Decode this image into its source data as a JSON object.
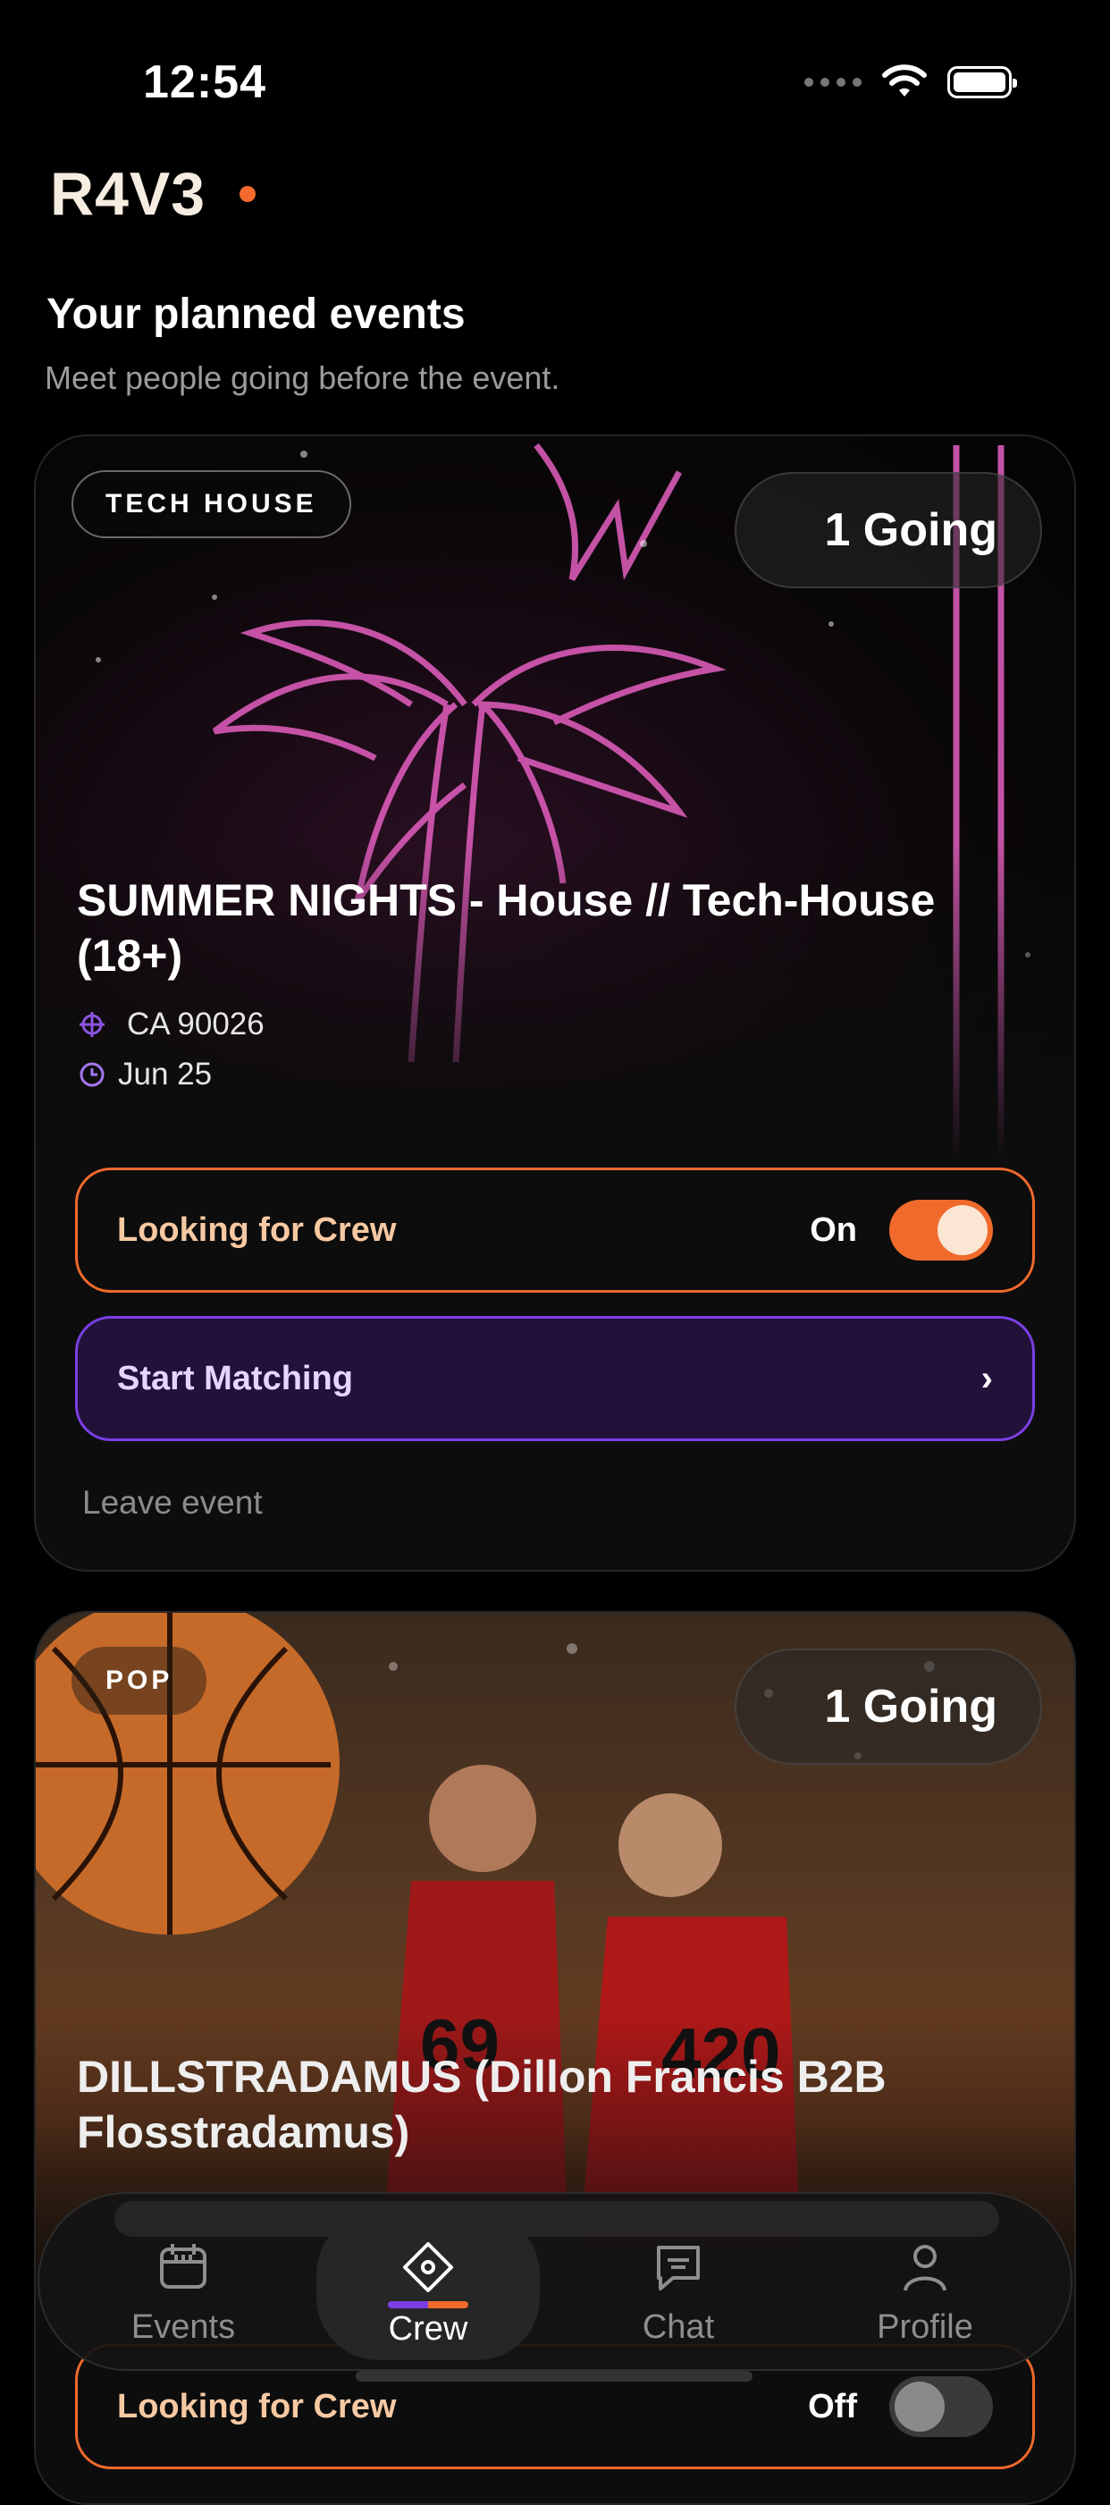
{
  "status": {
    "time": "12:54"
  },
  "header": {
    "brand": "R4V3",
    "section_title": "Your planned events",
    "section_subtitle": "Meet people going before the event."
  },
  "events": [
    {
      "genre": "TECH HOUSE",
      "going": "1 Going",
      "title": "SUMMER NIGHTS - House // Tech-House (18+)",
      "location": "CA 90026",
      "date": "Jun 25",
      "crew_label": "Looking for Crew",
      "crew_state": "On",
      "crew_on": true,
      "match_label": "Start Matching",
      "match_chevron": "›",
      "leave_label": "Leave event"
    },
    {
      "genre": "POP",
      "going": "1 Going",
      "title": "DILLSTRADAMUS (Dillon Francis B2B Flosstradamus)",
      "crew_label": "Looking for Crew",
      "crew_state": "Off",
      "crew_on": false
    }
  ],
  "tabs": [
    {
      "label": "Events",
      "icon": "calendar-icon"
    },
    {
      "label": "Crew",
      "icon": "diamond-icon",
      "active": true
    },
    {
      "label": "Chat",
      "icon": "chat-icon"
    },
    {
      "label": "Profile",
      "icon": "person-icon"
    }
  ],
  "colors": {
    "accent_orange": "#f06a2c",
    "accent_purple": "#7b3fe4",
    "background": "#000000"
  }
}
